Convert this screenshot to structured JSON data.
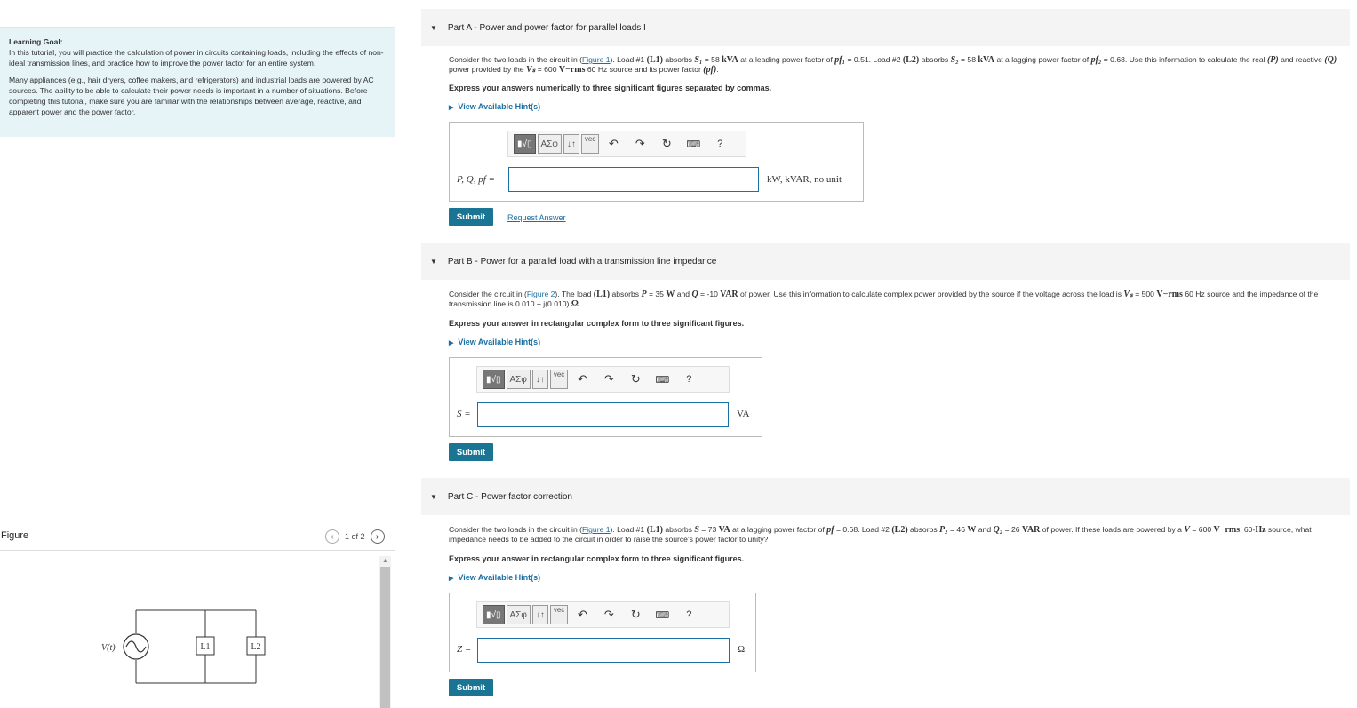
{
  "learning": {
    "title": "Learning Goal:",
    "p1": "In this tutorial, you will practice the calculation of power in circuits containing loads, including the effects of non-ideal transmission lines, and practice how to improve the power factor for an entire system.",
    "p2": "Many appliances (e.g., hair dryers, coffee makers, and refrigerators) and industrial loads are powered by AC sources. The ability to be able to calculate their power needs is important in a number of situations. Before completing this tutorial, make sure you are familiar with the relationships between average, reactive, and apparent power and the power factor."
  },
  "figure": {
    "label": "Figure",
    "pager": "1 of 2",
    "prev_icon": "chevron-left-icon",
    "next_icon": "chevron-right-icon",
    "source_label": "V(t)",
    "load1": "L1",
    "load2": "L2"
  },
  "toolbar": {
    "matrix": "▮√▯",
    "greek": "AΣφ",
    "arrows": "↓↑",
    "vec": "vec",
    "undo": "↶",
    "redo": "↷",
    "reset": "↻",
    "keyboard": "⌨",
    "help": "?"
  },
  "partA": {
    "header_prefix": "Part A",
    "header_title": " - Power and power factor for parallel loads I",
    "d1": "Consider the two loads in the circuit in (",
    "link": "Figure 1",
    "d2": "). Load #1 ",
    "l1": "(L1)",
    "d3": " absorbs ",
    "s1": "S₁",
    "d4": " = 58 ",
    "kva1": "kVA",
    "d5": " at a leading power factor of ",
    "pf1": "pf₁",
    "d6": " = 0.51. Load #2 ",
    "l2": "(L2)",
    "d7": " absorbs ",
    "s2": "S₂",
    "d8": " = 58 ",
    "kva2": "kVA",
    "d9": " at a lagging power factor of ",
    "pf2": "pf₂",
    "d10": " = 0.68. Use this information to calculate the real ",
    "p": "(P)",
    "d11": " and reactive ",
    "q": "(Q)",
    "d12": " power provided by the ",
    "vs": "Vₛ",
    "d13": " = 600 ",
    "vrms": "V−rms",
    "d14": " 60 Hz source and its power factor ",
    "pf": "(pf)",
    "d15": ".",
    "instruction": "Express your answers numerically to three significant figures separated by commas.",
    "hint": "View Available Hint(s)",
    "label": "P, Q, pf =",
    "unit": "kW, kVAR, no unit",
    "submit": "Submit",
    "request": "Request Answer"
  },
  "partB": {
    "header_prefix": "Part B",
    "header_title": " - Power for a parallel load with a transmission line impedance",
    "d1": "Consider the circuit in (",
    "link": "Figure 2",
    "d2": "). The load ",
    "l1": "(L1)",
    "d3": " absorbs ",
    "pv": "P",
    "d4": " = 35 ",
    "w": "W",
    "d5": " and ",
    "qv": "Q",
    "d6": " = -10 ",
    "var": "VAR",
    "d7": " of power. Use this information to calculate complex power provided by the source if the voltage across the load is ",
    "vs": "Vₛ",
    "d8": " = 500 ",
    "vrms": "V−rms",
    "d9": " 60 Hz source and the impedance of the transmission line is 0.010 + j(0.010) ",
    "ohm": "Ω",
    "d10": ".",
    "instruction": "Express your answer in rectangular complex form to three significant figures.",
    "hint": "View Available Hint(s)",
    "label": "S =",
    "unit": "VA",
    "submit": "Submit"
  },
  "partC": {
    "header_prefix": "Part C",
    "header_title": " - Power factor correction",
    "d1": "Consider the two loads in the circuit in (",
    "link": "Figure 1",
    "d2": "). Load #1 ",
    "l1": "(L1)",
    "d3": " absorbs ",
    "sv": "S",
    "d4": " = 73 ",
    "va": "VA",
    "d5": " at a lagging power factor of ",
    "pfv": "pf",
    "d6": " = 0.68. Load #2 ",
    "l2": "(L2)",
    "d7": " absorbs ",
    "p2": "P₂",
    "d8": " = 46 ",
    "w": "W",
    "d9": " and ",
    "q2": "Q₂",
    "d10": " = 26 ",
    "var": "VAR",
    "d11": " of power. If these loads are powered by a ",
    "v": "V",
    "d12": " = 600 ",
    "vrms": "V−rms",
    "d13": ", 60-",
    "hz": "Hz",
    "d14": " source, what impedance needs to be added to the circuit in order to raise the source's power factor to unity?",
    "instruction": "Express your answer in rectangular complex form to three significant figures.",
    "hint": "View Available Hint(s)",
    "label": "Z =",
    "unit": "Ω",
    "submit": "Submit"
  }
}
